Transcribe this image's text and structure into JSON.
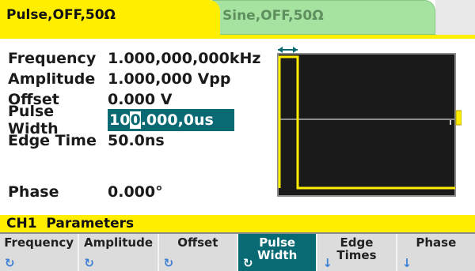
{
  "tabs": [
    {
      "label": "Pulse,OFF,50Ω"
    },
    {
      "label": "Sine,OFF,50Ω"
    }
  ],
  "parameters": [
    {
      "label": "Frequency",
      "value": "1.000,000,000kHz"
    },
    {
      "label": "Amplitude",
      "value": "1.000,000 Vpp"
    },
    {
      "label": "Offset",
      "value": "0.000 V"
    },
    {
      "label": "Pulse Width",
      "value_before_cursor": "10",
      "cursor_char": "0",
      "value_after_cursor": ".000,0us"
    },
    {
      "label": "Edge Time",
      "value": "50.0ns"
    },
    {
      "label": "Phase",
      "value": "0.000°"
    }
  ],
  "channel_bar": "CH1  Parameters",
  "softkeys": [
    {
      "line1": "Frequency",
      "line2": "",
      "icon": "knob-icon",
      "active": false
    },
    {
      "line1": "Amplitude",
      "line2": "",
      "icon": "knob-icon",
      "active": false
    },
    {
      "line1": "Offset",
      "line2": "",
      "icon": "knob-icon",
      "active": false
    },
    {
      "line1": "Pulse",
      "line2": "Width",
      "icon": "knob-icon",
      "active": true
    },
    {
      "line1": "Edge",
      "line2": "Times",
      "icon": "submenu-arrow-icon",
      "active": false
    },
    {
      "line1": "Phase",
      "line2": "",
      "icon": "submenu-arrow-icon",
      "active": false
    }
  ],
  "colors": {
    "tab_active": "#ffee00",
    "tab_inactive": "#a6e3a1",
    "selection": "#0a6a73",
    "waveform": "#ffee00"
  }
}
